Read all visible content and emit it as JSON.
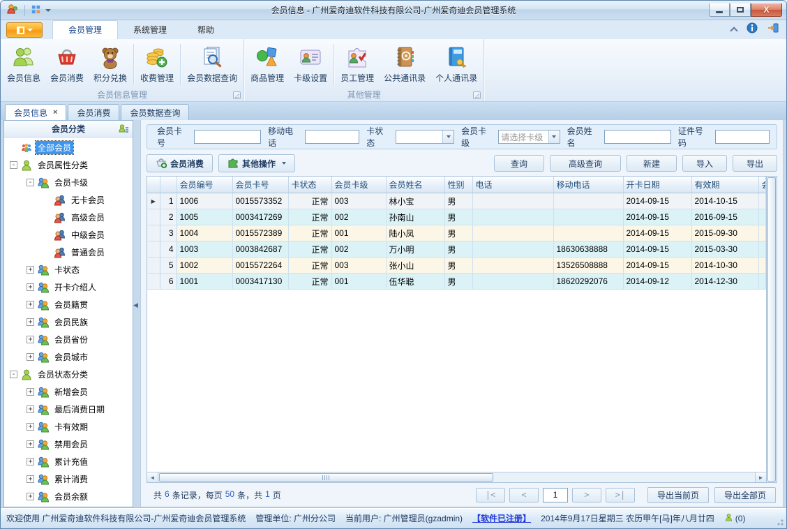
{
  "window": {
    "title": "会员信息 - 广州爱奇迪软件科技有限公司-广州爱奇迪会员管理系统"
  },
  "ribbon": {
    "tabs": [
      {
        "label": "会员管理",
        "active": true
      },
      {
        "label": "系统管理",
        "active": false
      },
      {
        "label": "帮助",
        "active": false
      }
    ],
    "groups": [
      {
        "label": "会员信息管理",
        "buttons": [
          {
            "label": "会员信息",
            "icon": "members-icon"
          },
          {
            "label": "会员消费",
            "icon": "basket-icon"
          },
          {
            "label": "积分兑换",
            "icon": "teddy-icon"
          },
          {
            "label": "收费管理",
            "icon": "coins-icon"
          },
          {
            "label": "会员数据查询",
            "icon": "doc-search-icon"
          }
        ]
      },
      {
        "label": "其他管理",
        "buttons": [
          {
            "label": "商品管理",
            "icon": "goods-icon"
          },
          {
            "label": "卡级设置",
            "icon": "card-icon"
          },
          {
            "label": "员工管理",
            "icon": "staff-puzzle-icon"
          },
          {
            "label": "公共通讯录",
            "icon": "public-addressbook-icon"
          },
          {
            "label": "个人通讯录",
            "icon": "personal-addressbook-icon"
          }
        ]
      }
    ]
  },
  "doc_tabs": [
    {
      "label": "会员信息",
      "close": "×",
      "active": true
    },
    {
      "label": "会员消费",
      "active": false
    },
    {
      "label": "会员数据查询",
      "active": false
    }
  ],
  "sidebar": {
    "header": "会员分类",
    "tree": [
      {
        "label": "全部会员",
        "level": 0,
        "box": "none",
        "icon": "group-icon",
        "selected": true
      },
      {
        "label": "会员属性分类",
        "level": 0,
        "box": "minus",
        "icon": "person-icon"
      },
      {
        "label": "会员卡级",
        "level": 1,
        "box": "minus",
        "icon": "duo-icon"
      },
      {
        "label": "无卡会员",
        "level": 2,
        "box": "none",
        "icon": "duo-red-icon"
      },
      {
        "label": "高级会员",
        "level": 2,
        "box": "none",
        "icon": "duo-red-icon"
      },
      {
        "label": "中级会员",
        "level": 2,
        "box": "none",
        "icon": "duo-red-icon"
      },
      {
        "label": "普通会员",
        "level": 2,
        "box": "none",
        "icon": "duo-red-icon"
      },
      {
        "label": "卡状态",
        "level": 1,
        "box": "plus",
        "icon": "duo-icon"
      },
      {
        "label": "开卡介绍人",
        "level": 1,
        "box": "plus",
        "icon": "duo-icon"
      },
      {
        "label": "会员籍贯",
        "level": 1,
        "box": "plus",
        "icon": "duo-icon"
      },
      {
        "label": "会员民族",
        "level": 1,
        "box": "plus",
        "icon": "duo-icon"
      },
      {
        "label": "会员省份",
        "level": 1,
        "box": "plus",
        "icon": "duo-icon"
      },
      {
        "label": "会员城市",
        "level": 1,
        "box": "plus",
        "icon": "duo-icon"
      },
      {
        "label": "会员状态分类",
        "level": 0,
        "box": "minus",
        "icon": "person-icon"
      },
      {
        "label": "新增会员",
        "level": 1,
        "box": "plus",
        "icon": "duo-icon"
      },
      {
        "label": "最后消费日期",
        "level": 1,
        "box": "plus",
        "icon": "duo-icon"
      },
      {
        "label": "卡有效期",
        "level": 1,
        "box": "plus",
        "icon": "duo-icon"
      },
      {
        "label": "禁用会员",
        "level": 1,
        "box": "plus",
        "icon": "duo-icon"
      },
      {
        "label": "累计充值",
        "level": 1,
        "box": "plus",
        "icon": "duo-icon"
      },
      {
        "label": "累计消费",
        "level": 1,
        "box": "plus",
        "icon": "duo-icon"
      },
      {
        "label": "会员余额",
        "level": 1,
        "box": "plus",
        "icon": "duo-icon"
      }
    ]
  },
  "filters": [
    {
      "label": "会员卡号",
      "type": "input",
      "value": ""
    },
    {
      "label": "移动电话",
      "type": "input",
      "value": ""
    },
    {
      "label": "卡状态",
      "type": "select",
      "value": ""
    },
    {
      "label": "会员卡级",
      "type": "select",
      "value": "请选择卡级"
    },
    {
      "label": "会员姓名",
      "type": "input",
      "value": ""
    },
    {
      "label": "证件号码",
      "type": "input",
      "value": ""
    }
  ],
  "actions": {
    "member_consume": "会员消费",
    "other_ops": "其他操作",
    "query": "查询",
    "adv_query": "高级查询",
    "new": "新建",
    "import": "导入",
    "export": "导出"
  },
  "table": {
    "columns": [
      "会员编号",
      "会员卡号",
      "卡状态",
      "会员卡级",
      "会员姓名",
      "性别",
      "电话",
      "移动电话",
      "开卡日期",
      "有效期",
      "会员"
    ],
    "rows": [
      {
        "num": "1",
        "current": true,
        "cells": [
          "1006",
          "0015573352",
          "正常",
          "003",
          "林小宝",
          "男",
          "",
          "",
          "2014-09-15",
          "2014-10-15",
          ""
        ]
      },
      {
        "num": "2",
        "current": false,
        "cells": [
          "1005",
          "0003417269",
          "正常",
          "002",
          "孙南山",
          "男",
          "",
          "",
          "2014-09-15",
          "2016-09-15",
          ""
        ]
      },
      {
        "num": "3",
        "current": false,
        "cells": [
          "1004",
          "0015572389",
          "正常",
          "001",
          "陆小凤",
          "男",
          "",
          "",
          "2014-09-15",
          "2015-09-30",
          ""
        ]
      },
      {
        "num": "4",
        "current": false,
        "cells": [
          "1003",
          "0003842687",
          "正常",
          "002",
          "万小明",
          "男",
          "",
          "18630638888",
          "2014-09-15",
          "2015-03-30",
          ""
        ]
      },
      {
        "num": "5",
        "current": false,
        "cells": [
          "1002",
          "0015572264",
          "正常",
          "003",
          "张小山",
          "男",
          "",
          "13526508888",
          "2014-09-15",
          "2014-10-30",
          ""
        ]
      },
      {
        "num": "6",
        "current": false,
        "cells": [
          "1001",
          "0003417130",
          "正常",
          "001",
          "伍华聪",
          "男",
          "",
          "18620292076",
          "2014-09-12",
          "2014-12-30",
          ""
        ]
      }
    ]
  },
  "pager": {
    "p1": "共",
    "v1": "6",
    "p2": "条记录，每页",
    "v2": "50",
    "p3": "条，共",
    "v3": "1",
    "p4": "页",
    "first": "|<",
    "prev": "<",
    "page": "1",
    "next": ">",
    "last": ">|",
    "export_current": "导出当前页",
    "export_all": "导出全部页"
  },
  "statusbar": {
    "welcome": "欢迎使用 广州爱奇迪软件科技有限公司-广州爱奇迪会员管理系统",
    "unit": "管理单位: 广州分公司",
    "user": "当前用户: 广州管理员(gzadmin)",
    "registered": "【软件已注册】",
    "date": "2014年9月17日星期三 农历甲午[马]年八月廿四",
    "online_count": "(0)"
  }
}
